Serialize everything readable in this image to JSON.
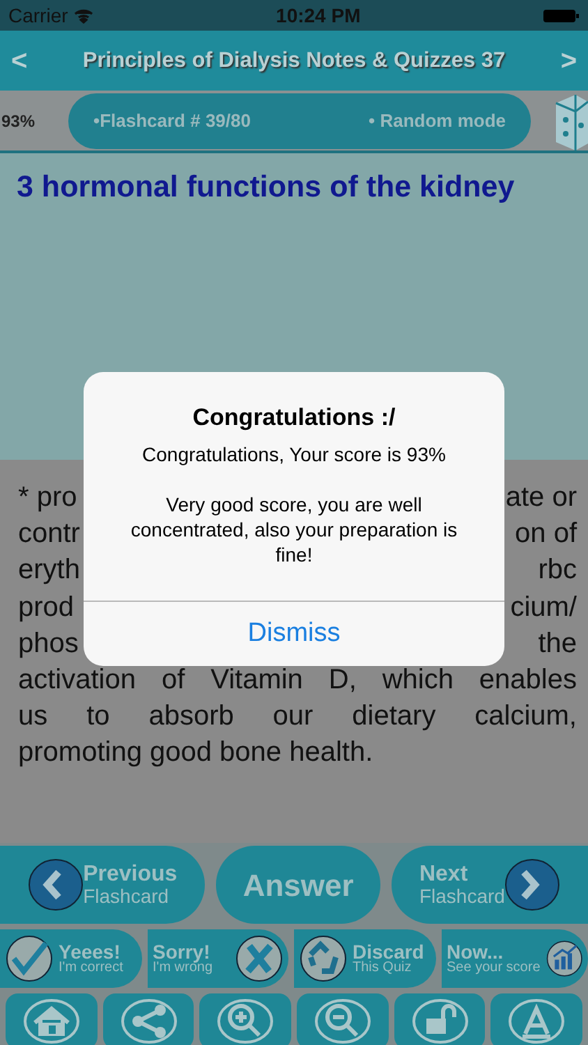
{
  "status_bar": {
    "carrier": "Carrier",
    "time": "10:24 PM"
  },
  "nav": {
    "back": "<",
    "title": "Principles of Dialysis Notes & Quizzes 37",
    "forward": ">"
  },
  "info_bar": {
    "score": "93%",
    "flashcard": "•Flashcard #  39/80",
    "mode": "• Random mode"
  },
  "card_title": "3 hormonal functions of the kidney",
  "body_lines": [
    {
      "left": "* pro",
      "right": "ate or"
    },
    {
      "left": "contr",
      "right": "on of"
    },
    {
      "left": "eryth",
      "right": "rbc"
    },
    {
      "left": "prod",
      "right": "cium/"
    },
    {
      "left": "phos",
      "right": "the"
    },
    {
      "full": "activation of Vitamin D, which enables"
    },
    {
      "full": "us to absorb our dietary calcium,"
    },
    {
      "full": "promoting good bone health."
    }
  ],
  "alert": {
    "title": "Congratulations :/",
    "score_message": "Congratulations, Your score is 93%",
    "message": "Very good score, you are well concentrated, also your preparation is fine!",
    "button": "Dismiss"
  },
  "nav_buttons": [
    {
      "kind": "prev",
      "line1": "Previous",
      "line2": "Flashcard"
    },
    {
      "kind": "answer",
      "line1": "Answer"
    },
    {
      "kind": "next",
      "line1": "Next",
      "line2": "Flashcard"
    }
  ],
  "mark_buttons": [
    {
      "kind": "correct",
      "line1": "Yeees!",
      "line2": "I'm correct"
    },
    {
      "kind": "wrong",
      "line1": "Sorry!",
      "line2": "I'm wrong"
    },
    {
      "kind": "discard",
      "line1": "Discard",
      "line2": "This Quiz"
    },
    {
      "kind": "score",
      "line1": "Now...",
      "line2": "See your score"
    }
  ],
  "tools": [
    {
      "kind": "home"
    },
    {
      "kind": "share"
    },
    {
      "kind": "zoom-in"
    },
    {
      "kind": "zoom-out"
    },
    {
      "kind": "unlock"
    },
    {
      "kind": "font"
    }
  ]
}
